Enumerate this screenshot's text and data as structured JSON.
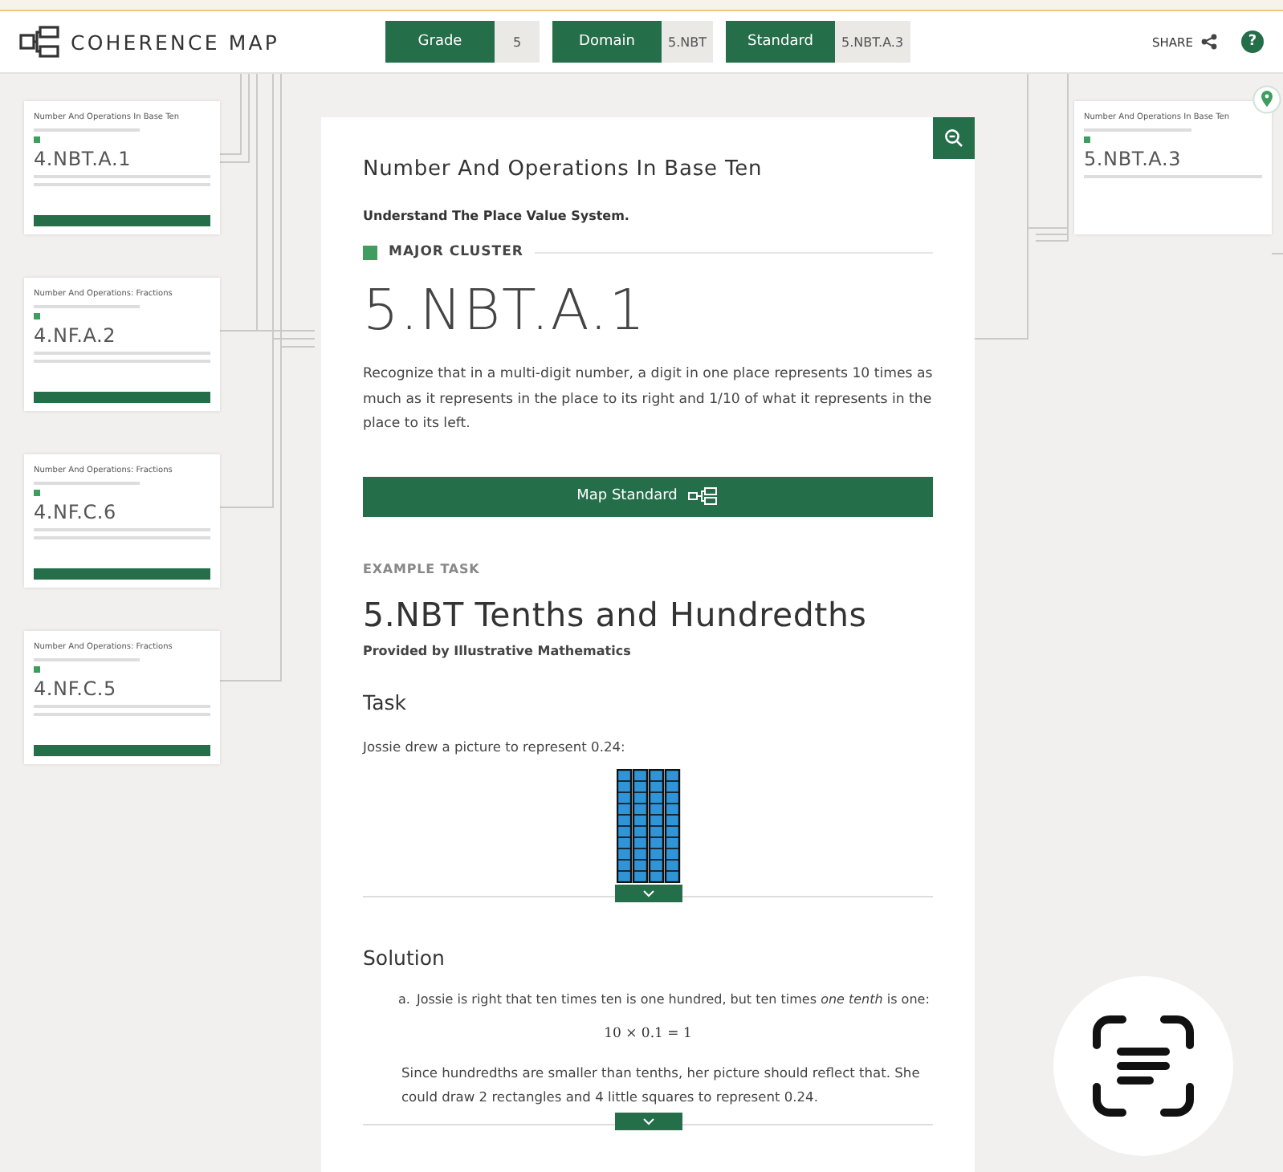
{
  "header": {
    "logo": "COHERENCE MAP",
    "filters": [
      {
        "label": "Grade",
        "value": "5"
      },
      {
        "label": "Domain",
        "value": "5.NBT"
      },
      {
        "label": "Standard",
        "value": "5.NBT.A.3"
      }
    ],
    "share": "SHARE",
    "help": "?"
  },
  "left_cards": [
    {
      "domain": "Number And Operations In Base Ten",
      "code": "4.NBT.A.1"
    },
    {
      "domain": "Number And Operations: Fractions",
      "code": "4.NF.A.2"
    },
    {
      "domain": "Number And Operations: Fractions",
      "code": "4.NF.C.6"
    },
    {
      "domain": "Number And Operations: Fractions",
      "code": "4.NF.C.5"
    }
  ],
  "right_card": {
    "domain": "Number And Operations In Base Ten",
    "code": "5.NBT.A.3"
  },
  "standard": {
    "domain": "Number And Operations In Base Ten",
    "cluster": "Understand The Place Value System.",
    "cluster_kind": "MAJOR CLUSTER",
    "code": "5.NBT.A.1",
    "description": "Recognize that in a multi-digit number, a digit in one place represents 10 times as much as it represents in the place to its right and 1/10 of what it represents in the place to its left.",
    "map_button": "Map Standard"
  },
  "example": {
    "label": "EXAMPLE TASK",
    "title": "5.NBT Tenths and Hundredths",
    "provider": "Provided by Illustrative Mathematics",
    "task_heading": "Task",
    "task_prompt": "Jossie drew a picture to represent 0.24:",
    "solution_heading": "Solution",
    "item_marker": "a.",
    "item_text": "Jossie is right that ten times ten is one hundred, but ten times *one tenth* is one:",
    "equation": "10 × 0.1 = 1",
    "item_paragraph": "Since hundredths are smaller than tenths, her picture should reflect that. She could draw 2 rectangles and 4 little squares to represent 0.24."
  }
}
